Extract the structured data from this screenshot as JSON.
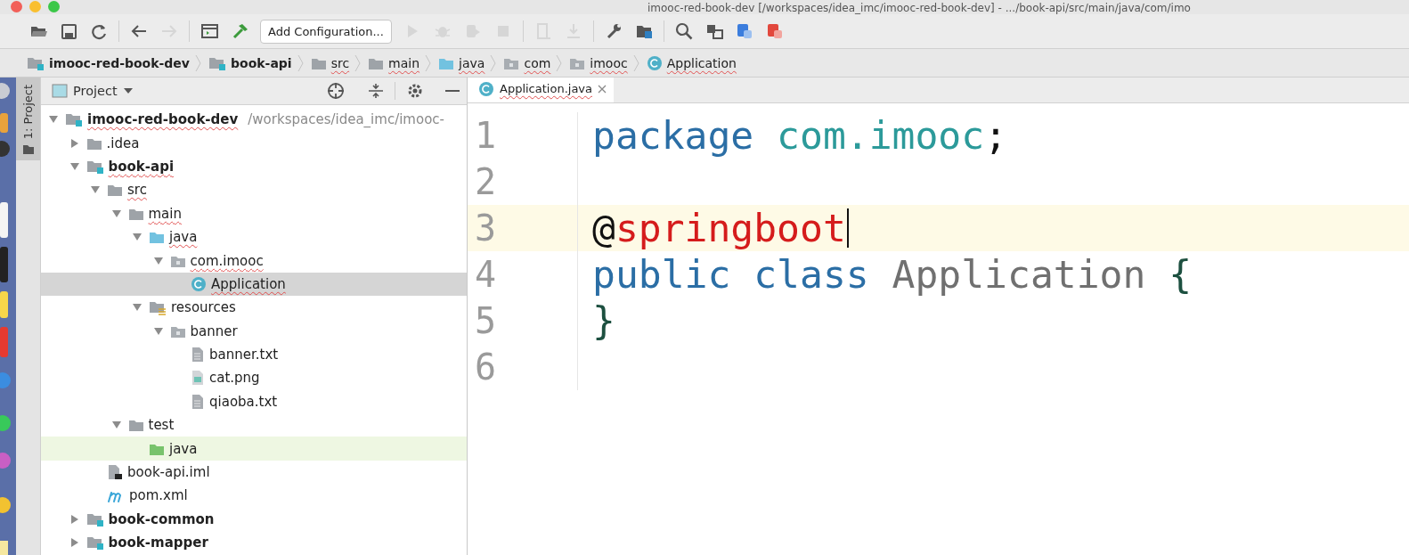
{
  "window": {
    "title": "imooc-red-book-dev [/workspaces/idea_imc/imooc-red-book-dev] - .../book-api/src/main/java/com/imo"
  },
  "toolbar": {
    "items": [
      {
        "kind": "open",
        "disabled": false
      },
      {
        "kind": "save",
        "disabled": false
      },
      {
        "kind": "sync",
        "disabled": false
      },
      {
        "kind": "separator"
      },
      {
        "kind": "back",
        "disabled": false
      },
      {
        "kind": "forward",
        "disabled": true
      },
      {
        "kind": "separator"
      },
      {
        "kind": "frame",
        "disabled": false
      },
      {
        "kind": "hammer",
        "disabled": false
      },
      {
        "kind": "run-config",
        "label": "Add Configuration..."
      },
      {
        "kind": "run",
        "disabled": true
      },
      {
        "kind": "debug",
        "disabled": true
      },
      {
        "kind": "coverage",
        "disabled": true
      },
      {
        "kind": "stop",
        "disabled": true
      },
      {
        "kind": "separator"
      },
      {
        "kind": "document",
        "disabled": true
      },
      {
        "kind": "person",
        "disabled": true
      },
      {
        "kind": "separator"
      },
      {
        "kind": "wrench",
        "disabled": false
      },
      {
        "kind": "structure",
        "disabled": false
      },
      {
        "kind": "separator"
      },
      {
        "kind": "search",
        "disabled": false
      },
      {
        "kind": "tasks",
        "disabled": false
      },
      {
        "kind": "translate-blue",
        "disabled": false
      },
      {
        "kind": "translate-red",
        "disabled": false
      }
    ]
  },
  "breadcrumbs": [
    {
      "label": "imooc-red-book-dev",
      "kind": "module",
      "typo": false
    },
    {
      "label": "book-api",
      "kind": "module",
      "typo": false
    },
    {
      "label": "src",
      "kind": "folder",
      "typo": true
    },
    {
      "label": "main",
      "kind": "folder",
      "typo": true
    },
    {
      "label": "java",
      "kind": "source",
      "typo": true
    },
    {
      "label": "com",
      "kind": "package",
      "typo": true
    },
    {
      "label": "imooc",
      "kind": "package",
      "typo": true
    },
    {
      "label": "Application",
      "kind": "class",
      "typo": true
    }
  ],
  "tool_stripe": {
    "label": "1: Project"
  },
  "project_panel": {
    "title": "Project",
    "tree": [
      {
        "name": "imooc-red-book-dev",
        "path": "/workspaces/idea_imc/imooc-",
        "kind": "module",
        "expanded": true,
        "selected": false,
        "typo": true,
        "children": [
          {
            "name": ".idea",
            "kind": "folder",
            "expanded": false,
            "selected": false,
            "typo": false
          },
          {
            "name": "book-api",
            "kind": "module",
            "expanded": true,
            "selected": false,
            "typo": true,
            "children": [
              {
                "name": "src",
                "kind": "folder",
                "expanded": true,
                "selected": false,
                "typo": true,
                "children": [
                  {
                    "name": "main",
                    "kind": "folder",
                    "expanded": true,
                    "selected": false,
                    "typo": true,
                    "children": [
                      {
                        "name": "java",
                        "kind": "source",
                        "expanded": true,
                        "selected": false,
                        "typo": true,
                        "children": [
                          {
                            "name": "com.imooc",
                            "kind": "package",
                            "expanded": true,
                            "selected": false,
                            "typo": true,
                            "children": [
                              {
                                "name": "Application",
                                "kind": "class",
                                "selected": true,
                                "typo": true
                              }
                            ]
                          }
                        ]
                      },
                      {
                        "name": "resources",
                        "kind": "resources",
                        "expanded": true,
                        "selected": false,
                        "typo": false,
                        "children": [
                          {
                            "name": "banner",
                            "kind": "package",
                            "expanded": true,
                            "selected": false,
                            "typo": false,
                            "children": [
                              {
                                "name": "banner.txt",
                                "kind": "text",
                                "selected": false,
                                "typo": false
                              },
                              {
                                "name": "cat.png",
                                "kind": "image",
                                "selected": false,
                                "typo": false
                              },
                              {
                                "name": "qiaoba.txt",
                                "kind": "text",
                                "selected": false,
                                "typo": false
                              }
                            ]
                          }
                        ]
                      }
                    ]
                  },
                  {
                    "name": "test",
                    "kind": "folder",
                    "expanded": true,
                    "selected": false,
                    "typo": false,
                    "children": [
                      {
                        "name": "java",
                        "kind": "test-source",
                        "selected": false,
                        "typo": false
                      }
                    ]
                  }
                ]
              },
              {
                "name": "book-api.iml",
                "kind": "iml",
                "selected": false,
                "typo": false
              },
              {
                "name": "pom.xml",
                "kind": "maven",
                "selected": false,
                "typo": false
              }
            ]
          },
          {
            "name": "book-common",
            "kind": "module",
            "expanded": false,
            "selected": false,
            "typo": false
          },
          {
            "name": "book-mapper",
            "kind": "module",
            "expanded": false,
            "selected": false,
            "typo": false
          }
        ]
      }
    ]
  },
  "editor": {
    "tab": {
      "label": "Application.java",
      "selected": true,
      "typo": true
    },
    "lines": [
      {
        "number": "1",
        "current": false,
        "tokens": [
          {
            "text": "package ",
            "kind": "keyword"
          },
          {
            "text": "com.imooc",
            "kind": "package"
          },
          {
            "text": ";",
            "kind": "plain"
          }
        ]
      },
      {
        "number": "2",
        "current": false
      },
      {
        "number": "3",
        "current": true,
        "tokens": [
          {
            "text": "@",
            "kind": "plain"
          },
          {
            "text": "springboot",
            "kind": "error"
          }
        ]
      },
      {
        "number": "4",
        "current": false,
        "tokens": [
          {
            "text": "public ",
            "kind": "keyword"
          },
          {
            "text": "class ",
            "kind": "keyword"
          },
          {
            "text": "Application ",
            "kind": "unused"
          },
          {
            "text": "{",
            "kind": "brace"
          }
        ]
      },
      {
        "number": "5",
        "current": false,
        "tokens": [
          {
            "text": "}",
            "kind": "brace"
          }
        ]
      },
      {
        "number": "6",
        "current": false
      }
    ]
  }
}
